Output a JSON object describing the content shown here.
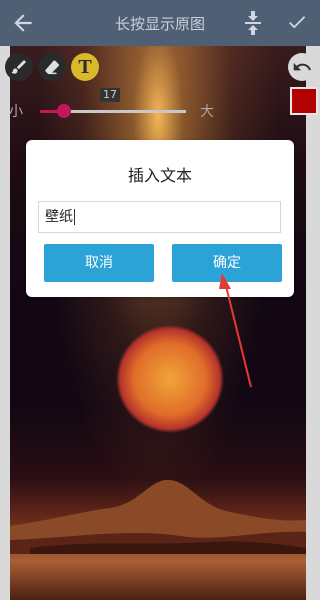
{
  "topbar": {
    "title": "长按显示原图"
  },
  "toolbar": {
    "text_tool_label": "T",
    "size_slider": {
      "min_label": "小",
      "max_label": "大",
      "value": "17"
    },
    "current_color": "#b30000"
  },
  "dialog": {
    "title": "插入文本",
    "input_value": "壁纸",
    "cancel_label": "取消",
    "confirm_label": "确定"
  },
  "colors": {
    "topbar_bg": "#4f5f74",
    "button_bg": "#2ba3d6",
    "slider_accent": "#c2185b",
    "annotation_arrow": "#e53935"
  }
}
